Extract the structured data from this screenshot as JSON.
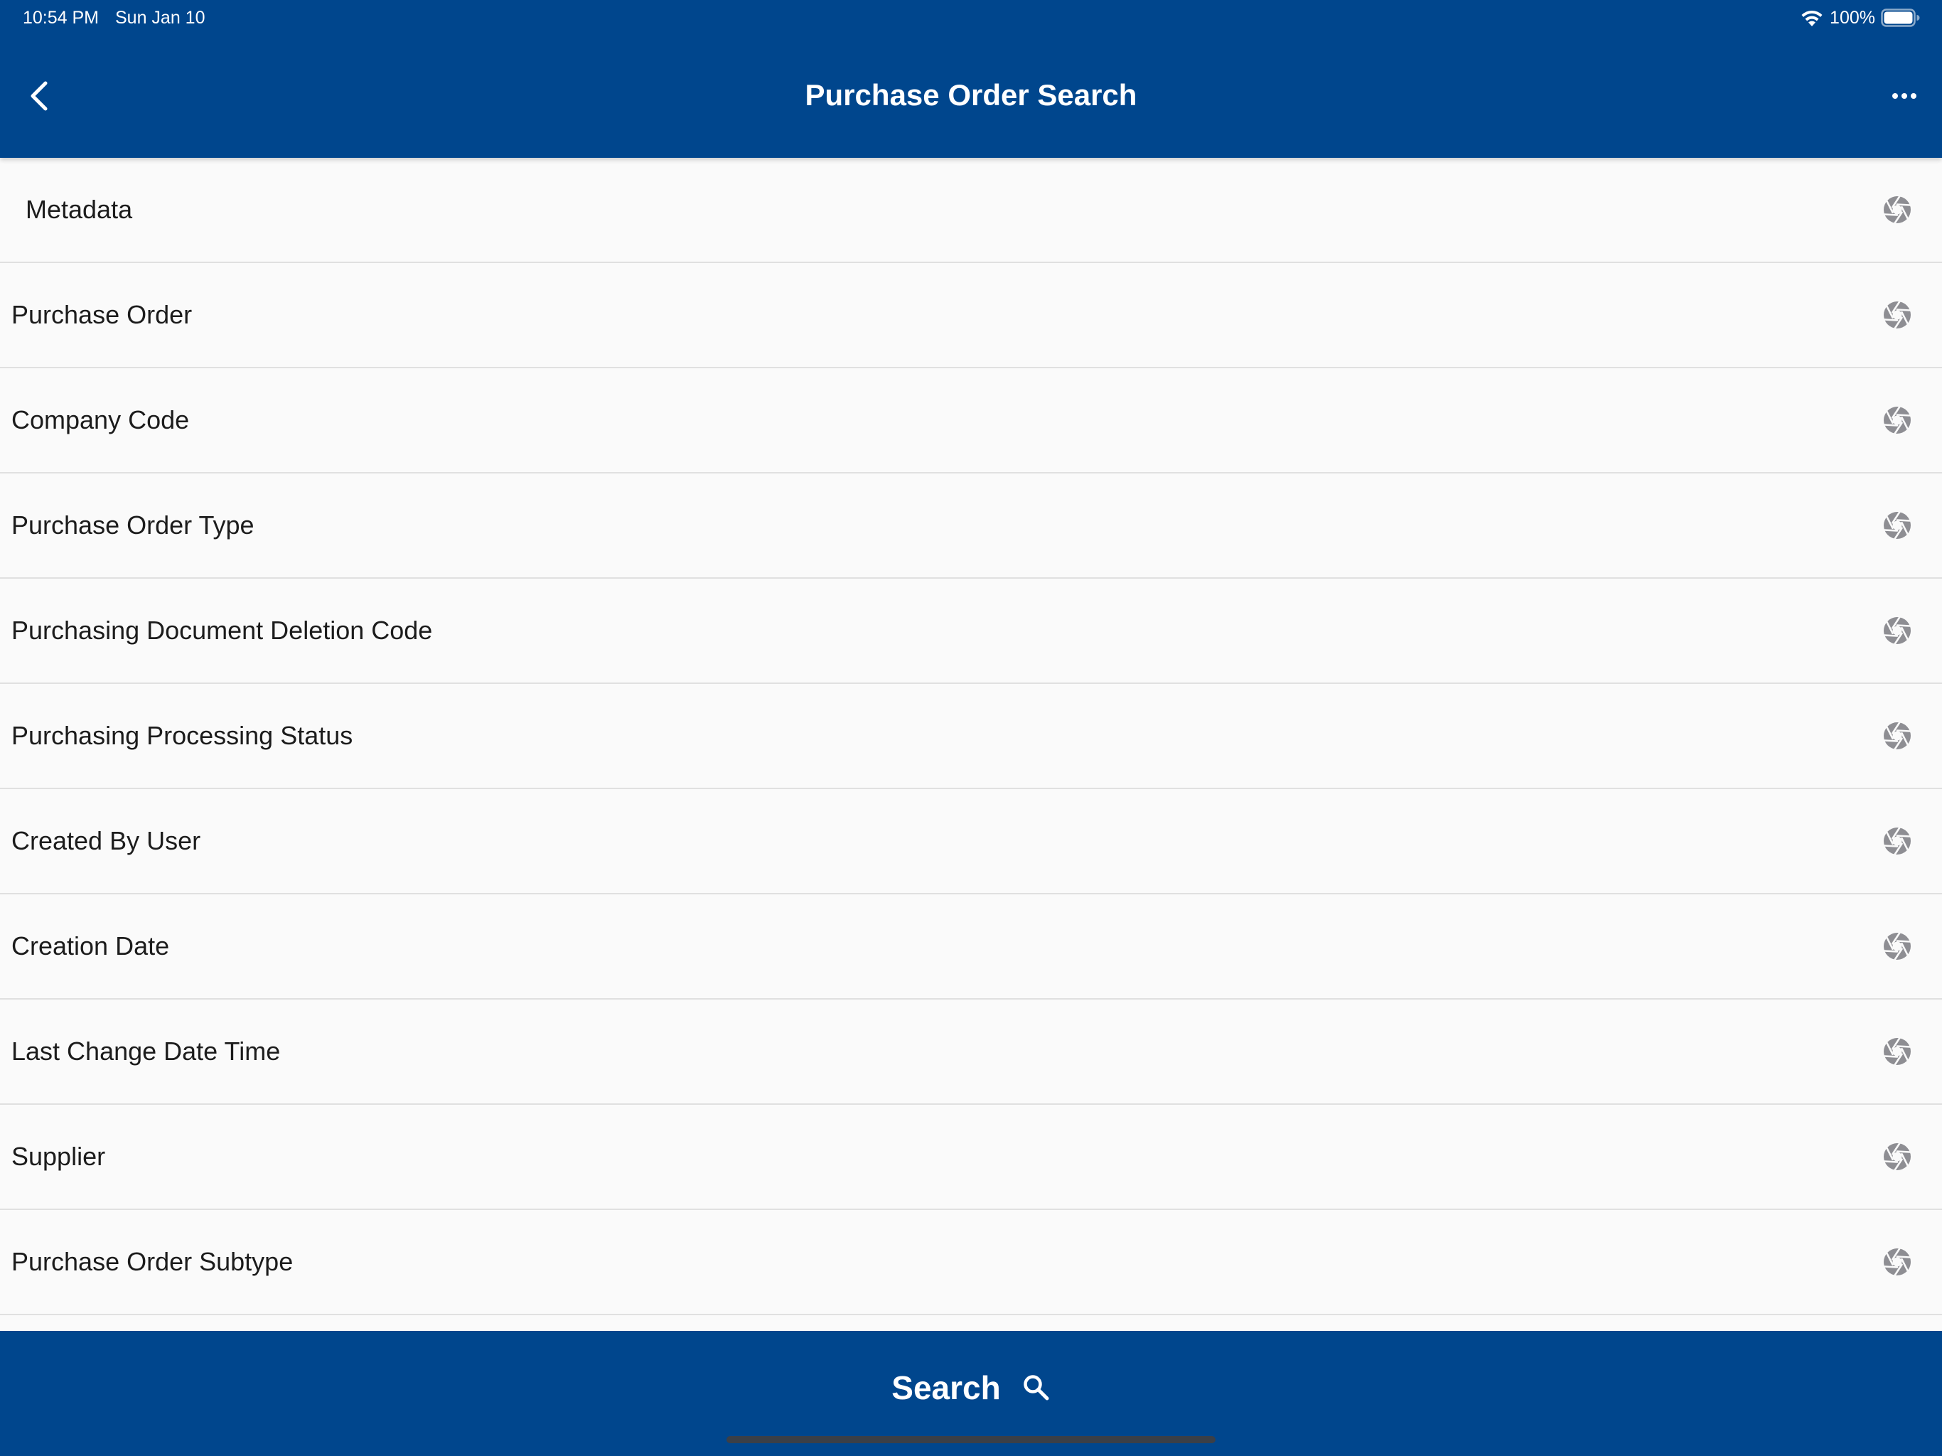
{
  "status_bar": {
    "time": "10:54 PM",
    "date": "Sun Jan 10",
    "battery": "100%",
    "icons": [
      "wifi-icon",
      "battery-icon"
    ]
  },
  "header": {
    "title": "Purchase Order Search",
    "back_icon": "chevron-left-icon",
    "more_icon": "ellipsis-icon"
  },
  "fields": [
    {
      "label": "Metadata"
    },
    {
      "label": "Purchase Order"
    },
    {
      "label": "Company Code"
    },
    {
      "label": "Purchase Order Type"
    },
    {
      "label": "Purchasing Document Deletion Code"
    },
    {
      "label": "Purchasing Processing Status"
    },
    {
      "label": "Created By User"
    },
    {
      "label": "Creation Date"
    },
    {
      "label": "Last Change Date Time"
    },
    {
      "label": "Supplier"
    },
    {
      "label": "Purchase Order Subtype"
    }
  ],
  "field_icon": "aperture-icon",
  "footer": {
    "search_label": "Search",
    "search_icon": "search-icon"
  },
  "colors": {
    "primary": "#00468d",
    "background": "#fafafa",
    "text": "#1c1c1c",
    "icon": "#8e8e93",
    "divider": "#e0e0e0"
  }
}
